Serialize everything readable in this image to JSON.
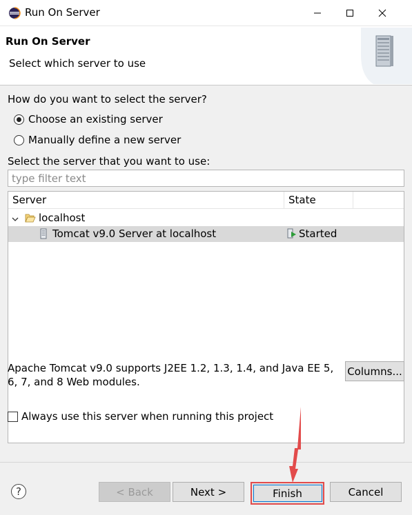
{
  "window": {
    "title": "Run On Server"
  },
  "header": {
    "title": "Run On Server",
    "description": "Select which server to use"
  },
  "selection": {
    "question": "How do you want to select the server?",
    "options": [
      {
        "label": "Choose an existing server",
        "selected": true
      },
      {
        "label": "Manually define a new server",
        "selected": false
      }
    ],
    "list_label": "Select the server that you want to use:",
    "filter_placeholder": "type filter text"
  },
  "tree": {
    "columns": [
      "Server",
      "State"
    ],
    "group": {
      "label": "localhost"
    },
    "servers": [
      {
        "name": "Tomcat v9.0 Server at localhost",
        "state": "Started"
      }
    ]
  },
  "info": "Apache Tomcat v9.0 supports J2EE 1.2, 1.3, 1.4, and Java EE 5, 6, 7, and 8 Web modules.",
  "columns_button": "Columns...",
  "always_use": {
    "label": "Always use this server when running this project",
    "checked": false
  },
  "footer": {
    "help": "?",
    "back": "< Back",
    "next": "Next >",
    "finish": "Finish",
    "cancel": "Cancel"
  },
  "colors": {
    "highlight": "#e24b4b",
    "focus": "#0078d7",
    "selected_row": "#d9d9d9"
  }
}
